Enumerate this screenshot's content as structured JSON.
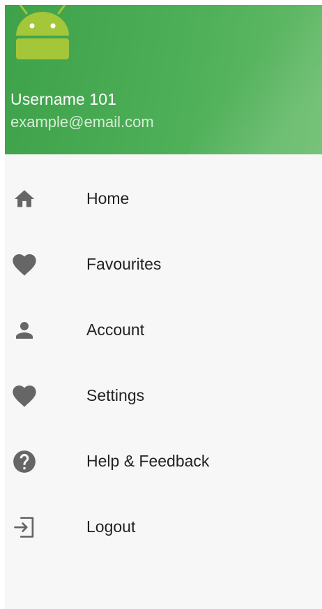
{
  "header": {
    "avatar_icon": "android-icon",
    "username": "Username 101",
    "email": "example@email.com",
    "colors": {
      "gradient_start": "#3ea24a",
      "gradient_end": "#66bb6a",
      "avatar": "#a4c639"
    }
  },
  "menu": {
    "icon_color": "#666666",
    "items": [
      {
        "label": "Home",
        "icon": "home-icon"
      },
      {
        "label": "Favourites",
        "icon": "heart-icon"
      },
      {
        "label": "Account",
        "icon": "person-icon"
      },
      {
        "label": "Settings",
        "icon": "heart-icon"
      },
      {
        "label": "Help & Feedback",
        "icon": "help-icon"
      },
      {
        "label": "Logout",
        "icon": "logout-icon"
      }
    ]
  }
}
